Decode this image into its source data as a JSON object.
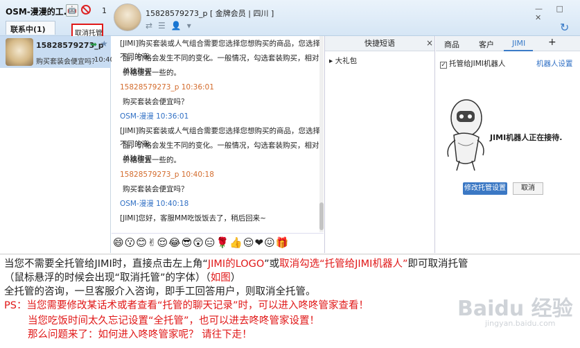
{
  "topbar": {
    "left_title": "OSM-漫漫的工...",
    "count": "1",
    "tab_contacts": "联系中(1)",
    "tooltip": "取消托管",
    "user_title": "15828579273_p  [ 金牌会员 | 四川 ]",
    "window_controls": "— □ ✕"
  },
  "contact": {
    "name": "15828579273_p",
    "last_msg": "购买套装会便宜吗？",
    "time": "10:40"
  },
  "chat": {
    "messages": [
      {
        "text": "[JIMI]购买套装或人气组合需要您选择您想购买的商品，您选择不同的商",
        "type": "body"
      },
      {
        "text": "品，价格会发生不同的变化。一般情况，勾选套装购买，相对单独购买",
        "type": "body"
      },
      {
        "text": "价格便宜一些的。",
        "type": "body"
      },
      {
        "text": "15828579273_p  10:36:01",
        "type": "cust"
      },
      {
        "text": "购买套装会便宜吗？",
        "type": "body"
      },
      {
        "text": "OSM-漫漫  10:36:01",
        "type": "agent"
      },
      {
        "text": "[JIMI]购买套装或人气组合需要您选择您想购买的商品，您选择不同的商",
        "type": "body"
      },
      {
        "text": "品，价格会发生不同的变化。一般情况，勾选套装购买，相对单独购买",
        "type": "body"
      },
      {
        "text": "价格便宜一些的。",
        "type": "body"
      },
      {
        "text": "15828579273_p  10:40:18",
        "type": "cust"
      },
      {
        "text": "购买套装会便宜吗？",
        "type": "body"
      },
      {
        "text": "OSM-漫漫  10:40:18",
        "type": "agent"
      },
      {
        "text": "[JIMI]您好，客服MM吃饭饭去了，稍后回来~",
        "type": "body"
      }
    ],
    "emojis": "😄😗😊✌😌😂😎😲😑🌹👍😌❤😖🎁"
  },
  "quick": {
    "title": "快捷短语",
    "close": "×",
    "item": "▸  大礼包"
  },
  "right": {
    "tabs": [
      "商品",
      "客户",
      "JIMI",
      "+"
    ],
    "checkbox_label": "托管给JIMI机器人",
    "robot_setting": "机器人设置",
    "robot_status": "JIMI机器人正在接待.",
    "btn_modify": "修改托管设置",
    "btn_cancel": "取消"
  },
  "annotation": {
    "l1a": "当您不需要全托管给JIMI时，直接点击左上角“",
    "l1b": "JIMI的LOGO",
    "l1c": "”或",
    "l1d": "取消勾选“托管给JIMI机器人”",
    "l1e": "即可取消托管",
    "l2a": "（鼠标悬浮的时候会出现“取消托管”的字体）（",
    "l2b": "如图",
    "l2c": "）",
    "l3": "全托管的咨询，一旦客服介入咨询，即手工回答用户，则取消全托管。",
    "l4": "PS：当您需要修改某话术或者查看“托管的聊天记录”时，可以进入咚咚管家查看！",
    "l5": "当您吃饭时间太久忘记设置“全托管”，也可以进去咚咚管家设置！",
    "l6": "那么问题来了：如何进入咚咚管家呢？ 请往下走！"
  },
  "watermark": {
    "brand": "Baidu 经验",
    "sub": "jingyan.baidu.com"
  },
  "colors": {
    "accent": "#3b78c4",
    "red": "#e01818",
    "selected_row": "#c8dcf2"
  }
}
